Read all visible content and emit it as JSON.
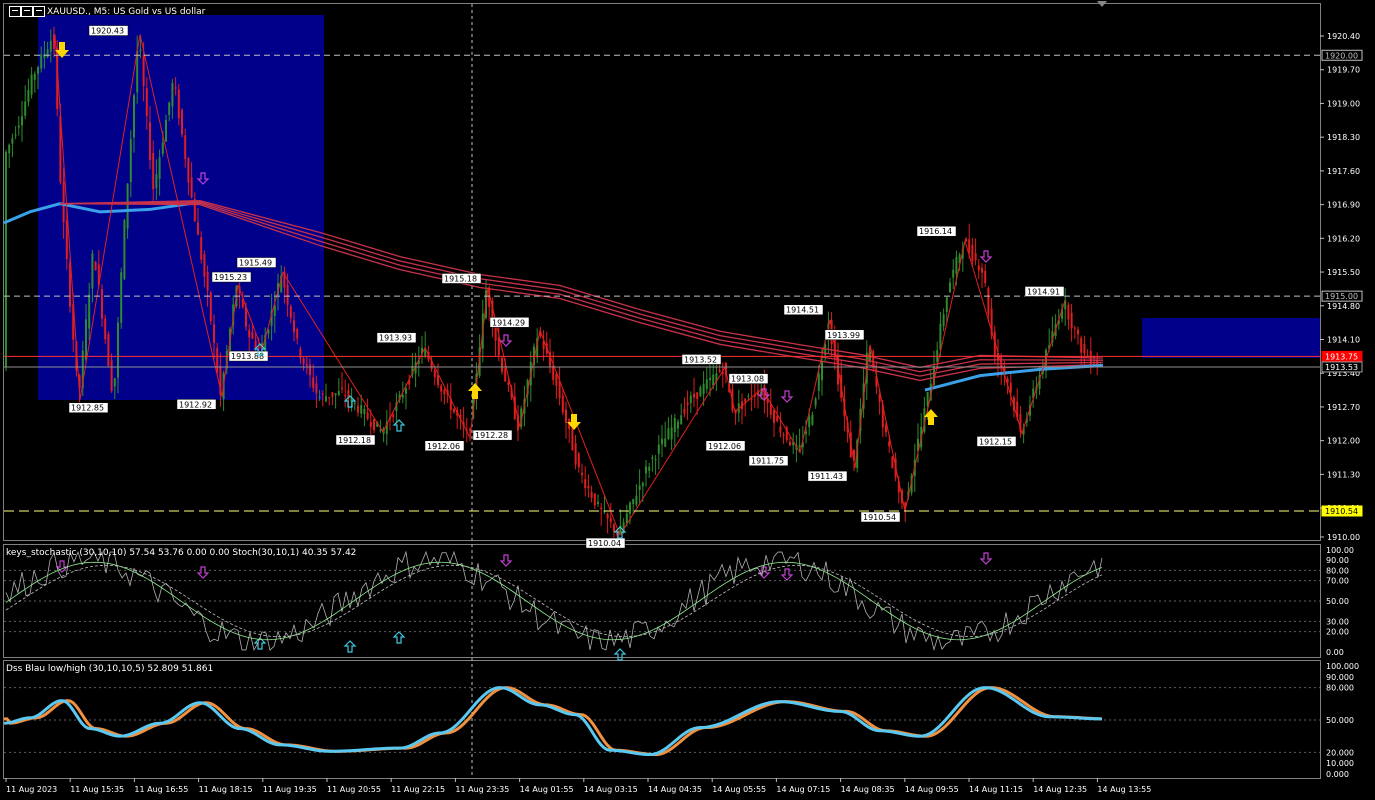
{
  "header": {
    "symbol_title": "XAUUSD., M5:  US Gold vs US dollar"
  },
  "indicators": {
    "stochastic_title": "keys_stochastic (30,10,10) 57.54 53.76 0.00 0.00 Stoch(30,10,1) 40.35 57.42",
    "dss_title": "Dss Blau low/high (30,10,10,5) 52.809 51.861"
  },
  "price_axis": {
    "ticks": [
      "1920.40",
      "1919.70",
      "1919.00",
      "1918.30",
      "1917.60",
      "1916.90",
      "1916.20",
      "1915.50",
      "1914.80",
      "1914.10",
      "1913.40",
      "1912.70",
      "1912.00",
      "1911.30",
      "1910.60",
      "1910.00"
    ],
    "tags": [
      {
        "label": "1920.00",
        "bg": "#000000",
        "fg": "#c0c0c0",
        "border": "#c0c0c0"
      },
      {
        "label": "1915.00",
        "bg": "#000000",
        "fg": "#c0c0c0",
        "border": "#c0c0c0"
      },
      {
        "label": "1913.75",
        "bg": "#ff0000",
        "fg": "#ffffff",
        "border": "#ff0000"
      },
      {
        "label": "1913.53",
        "bg": "#000000",
        "fg": "#ffffff",
        "border": "#a0a0a0"
      },
      {
        "label": "1910.54",
        "bg": "#ffff00",
        "fg": "#000000",
        "border": "#ffff00"
      }
    ]
  },
  "stoch_axis": [
    "100.00",
    "90.00",
    "80.00",
    "70.00",
    "50.00",
    "30.00",
    "20.00",
    "0.00"
  ],
  "dss_axis": [
    "100.000",
    "90.000",
    "80.000",
    "50.000",
    "20.000",
    "10.000",
    "0.000"
  ],
  "time_axis": [
    "11 Aug 2023",
    "11 Aug 15:35",
    "11 Aug 16:55",
    "11 Aug 18:15",
    "11 Aug 19:35",
    "11 Aug 20:55",
    "11 Aug 22:15",
    "11 Aug 23:35",
    "14 Aug 01:55",
    "14 Aug 03:15",
    "14 Aug 04:35",
    "14 Aug 05:55",
    "14 Aug 07:15",
    "14 Aug 08:35",
    "14 Aug 09:55",
    "14 Aug 11:15",
    "14 Aug 12:35",
    "14 Aug 13:55"
  ],
  "zigzag_labels": [
    "1920.43",
    "1912.85",
    "1915.49",
    "1915.23",
    "1912.92",
    "1913.88",
    "1912.18",
    "1913.93",
    "1912.06",
    "1915.18",
    "1914.29",
    "1912.28",
    "1910.04",
    "1913.52",
    "1912.06",
    "1913.08",
    "1911.75",
    "1914.51",
    "1911.43",
    "1913.99",
    "1910.54",
    "1916.14",
    "1912.15",
    "1914.91"
  ],
  "colors": {
    "background": "#000000",
    "bull_candle": "#2e8b2e",
    "bear_candle": "#e01e1e",
    "zone": "#00008b",
    "ma_red": "#c8324a",
    "ma_blue": "#3aa0e8",
    "zigzag": "#e02020",
    "signal_yellow": "#ffd700",
    "arrow_cyan": "#40c8e0",
    "arrow_magenta": "#c040d0",
    "dss_blue": "#5ac8f0",
    "dss_orange": "#f09040"
  }
}
